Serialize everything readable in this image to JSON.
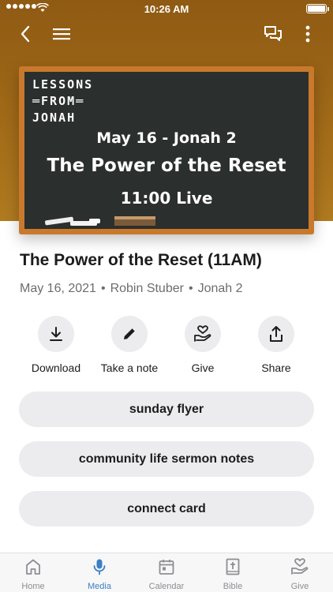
{
  "status_bar": {
    "time": "10:26 AM"
  },
  "colors": {
    "accent": "#3b7fc4",
    "hero": "#9a6416",
    "board": "#2b2f2d",
    "frame": "#c9792b"
  },
  "nav": {
    "back_icon": "back-chevron-icon",
    "menu_icon": "hamburger-menu-icon",
    "chat_icon": "chat-icon",
    "more_icon": "more-vertical-icon"
  },
  "artwork": {
    "lessons_line1": "LESSONS",
    "lessons_line2": "═FROM═",
    "lessons_line3": "JONAH",
    "line1": "May 16 - Jonah 2",
    "line2": "The Power of the Reset",
    "line3": "11:00 Live"
  },
  "sermon": {
    "title": "The Power of the Reset (11AM)",
    "date": "May 16, 2021",
    "speaker": "Robin Stuber",
    "passage": "Jonah 2",
    "separator": "•"
  },
  "actions": [
    {
      "label": "Download",
      "icon": "download-icon"
    },
    {
      "label": "Take a note",
      "icon": "pencil-icon"
    },
    {
      "label": "Give",
      "icon": "give-hand-heart-icon"
    },
    {
      "label": "Share",
      "icon": "share-icon"
    }
  ],
  "links": [
    {
      "label": "sunday flyer"
    },
    {
      "label": "community life sermon notes"
    },
    {
      "label": "connect card"
    }
  ],
  "tabs": [
    {
      "label": "Home",
      "icon": "home-icon"
    },
    {
      "label": "Media",
      "icon": "microphone-icon",
      "active": true
    },
    {
      "label": "Calendar",
      "icon": "calendar-icon"
    },
    {
      "label": "Bible",
      "icon": "bible-icon"
    },
    {
      "label": "Give",
      "icon": "give-icon"
    }
  ]
}
